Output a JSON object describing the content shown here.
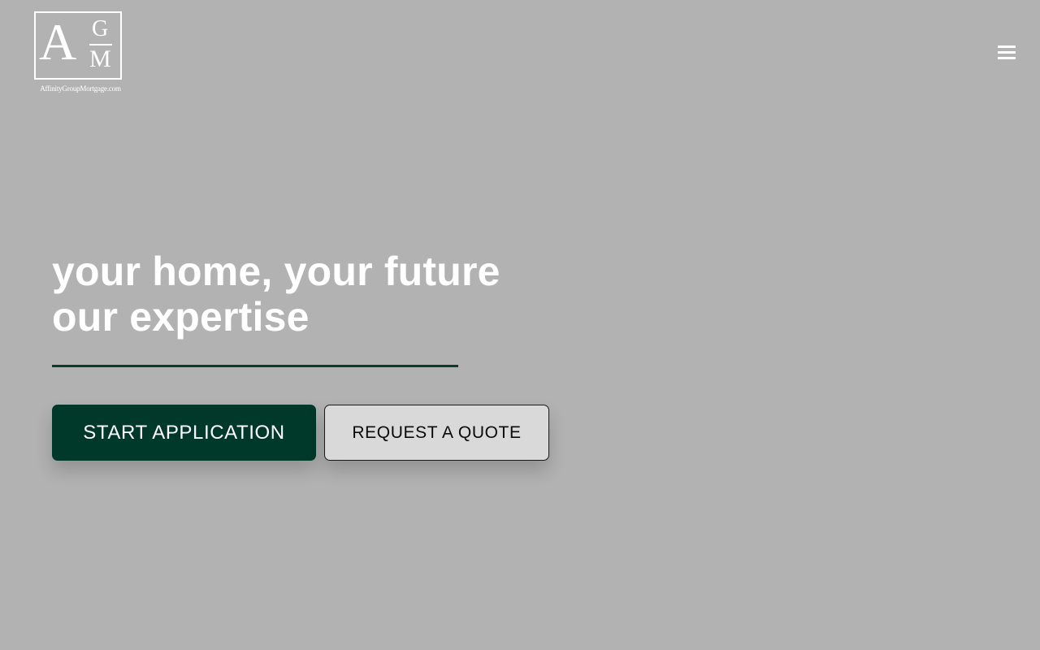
{
  "brand": {
    "logo_letter_a": "A",
    "logo_letter_g": "G",
    "logo_letter_m": "M",
    "logo_url_text": "AffinityGroupMortgage.com",
    "logo_color": "#ffffff"
  },
  "header": {
    "menu_icon": "hamburger-menu-icon"
  },
  "hero": {
    "title_line_1": "your home, your future",
    "title_line_2": "our expertise",
    "divider_color": "#0e3a2e"
  },
  "actions": {
    "primary_label": "START APPLICATION",
    "secondary_label": "REQUEST A QUOTE",
    "primary_color": "#00382a",
    "secondary_color": "#d9d9d9"
  },
  "colors": {
    "background": "#b2b2b2",
    "text": "#ffffff"
  }
}
